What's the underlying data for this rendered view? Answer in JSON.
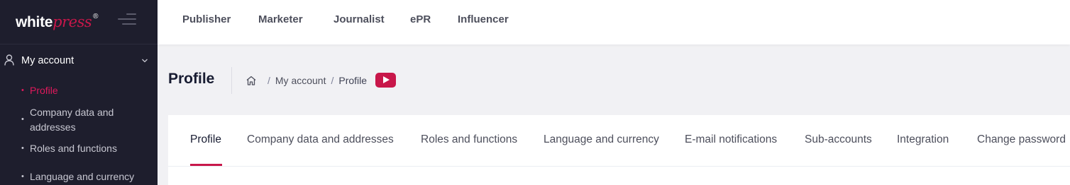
{
  "brand": {
    "name_part1": "white",
    "name_part2": "press",
    "registered": "®",
    "accent_color": "#c8174a",
    "sidebar_bg": "#1e1e2d"
  },
  "topnav": {
    "items": [
      "Publisher",
      "Marketer",
      "Journalist",
      "ePR",
      "Influencer"
    ]
  },
  "sidebar": {
    "section_label": "My account",
    "section_icon": "user-icon",
    "items": [
      {
        "label": "Profile",
        "active": true
      },
      {
        "label": "Company data and addresses",
        "active": false
      },
      {
        "label": "Roles and functions",
        "active": false
      },
      {
        "label": "Language and currency",
        "active": false
      }
    ]
  },
  "header": {
    "title": "Profile",
    "breadcrumb": {
      "home_icon": "home-icon",
      "items": [
        "My account",
        "Profile"
      ],
      "separator": "/"
    },
    "video_icon": "youtube-icon"
  },
  "tabs": {
    "items": [
      {
        "label": "Profile",
        "active": true
      },
      {
        "label": "Company data and addresses",
        "active": false
      },
      {
        "label": "Roles and functions",
        "active": false
      },
      {
        "label": "Language and currency",
        "active": false
      },
      {
        "label": "E-mail notifications",
        "active": false
      },
      {
        "label": "Sub-accounts",
        "active": false
      },
      {
        "label": "Integration",
        "active": false
      },
      {
        "label": "Change password",
        "active": false
      }
    ]
  }
}
